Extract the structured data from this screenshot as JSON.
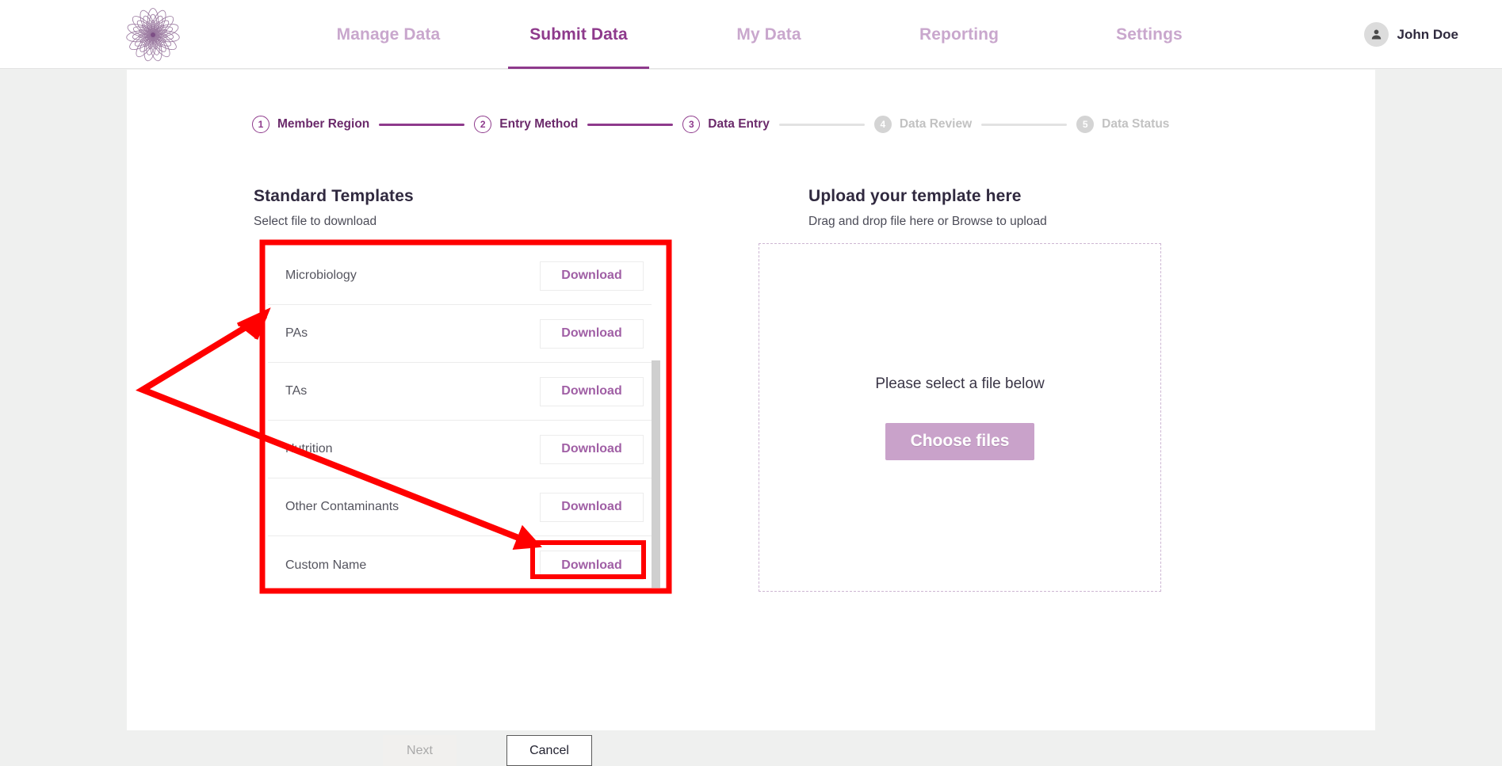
{
  "header": {
    "logo_icon": "flower-mandala-logo",
    "nav": [
      {
        "label": "Manage Data",
        "active": false
      },
      {
        "label": "Submit Data",
        "active": true
      },
      {
        "label": "My Data",
        "active": false
      },
      {
        "label": "Reporting",
        "active": false
      },
      {
        "label": "Settings",
        "active": false
      }
    ],
    "user": {
      "name": "John Doe",
      "avatar_icon": "person-icon"
    }
  },
  "stepper": {
    "steps": [
      {
        "num": "1",
        "label": "Member Region",
        "state": "done"
      },
      {
        "num": "2",
        "label": "Entry Method",
        "state": "done"
      },
      {
        "num": "3",
        "label": "Data Entry",
        "state": "done"
      },
      {
        "num": "4",
        "label": "Data Review",
        "state": "todo"
      },
      {
        "num": "5",
        "label": "Data Status",
        "state": "todo"
      }
    ]
  },
  "templates_panel": {
    "title": "Standard Templates",
    "subtitle": "Select file to download",
    "rows": [
      {
        "name": "Microbiology",
        "action": "Download",
        "highlighted": false
      },
      {
        "name": "PAs",
        "action": "Download",
        "highlighted": false
      },
      {
        "name": "TAs",
        "action": "Download",
        "highlighted": false
      },
      {
        "name": "Nutrition",
        "action": "Download",
        "highlighted": false
      },
      {
        "name": "Other Contaminants",
        "action": "Download",
        "highlighted": false
      },
      {
        "name": "Custom Name",
        "action": "Download",
        "highlighted": true
      }
    ]
  },
  "upload_panel": {
    "title": "Upload your template here",
    "subtitle": "Drag and drop file here or Browse to upload",
    "dropzone_text": "Please select a file below",
    "choose_button": "Choose files"
  },
  "footer": {
    "next_label": "Next",
    "cancel_label": "Cancel"
  },
  "colors": {
    "brand_purple": "#8e3a8c",
    "nav_inactive": "#c9a7cd",
    "accent_link": "#a05fa5",
    "choose_button_bg": "#c9a2ca",
    "annotation_red": "#ff0000",
    "page_bg": "#eff0ef"
  }
}
